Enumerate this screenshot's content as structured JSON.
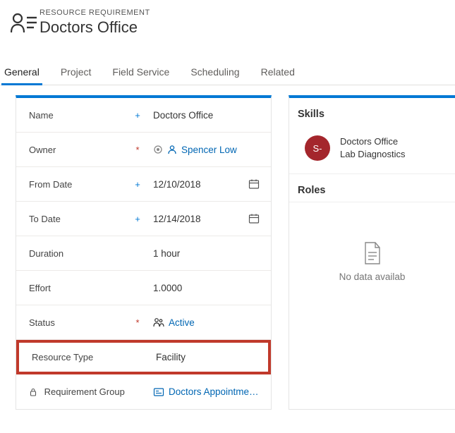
{
  "header": {
    "supertitle": "RESOURCE REQUIREMENT",
    "title": "Doctors Office"
  },
  "tabs": [
    {
      "label": "General",
      "active": true
    },
    {
      "label": "Project"
    },
    {
      "label": "Field Service"
    },
    {
      "label": "Scheduling"
    },
    {
      "label": "Related"
    }
  ],
  "fields": {
    "name": {
      "label": "Name",
      "marker": "+",
      "value": "Doctors Office"
    },
    "owner": {
      "label": "Owner",
      "marker": "*",
      "value": "Spencer Low"
    },
    "from_date": {
      "label": "From Date",
      "marker": "+",
      "value": "12/10/2018"
    },
    "to_date": {
      "label": "To Date",
      "marker": "+",
      "value": "12/14/2018"
    },
    "duration": {
      "label": "Duration",
      "marker": "",
      "value": "1 hour"
    },
    "effort": {
      "label": "Effort",
      "marker": "",
      "value": "1.0000"
    },
    "status": {
      "label": "Status",
      "marker": "*",
      "value": "Active"
    },
    "resource_type": {
      "label": "Resource Type",
      "marker": "",
      "value": "Facility"
    },
    "req_group": {
      "label": "Requirement Group",
      "marker": "",
      "value": "Doctors Appointme…"
    }
  },
  "right": {
    "skills_header": "Skills",
    "skill_avatar_initials": "S-",
    "skill_line1": "Doctors Office",
    "skill_line2": "Lab Diagnostics",
    "roles_header": "Roles",
    "roles_empty": "No data availab"
  }
}
